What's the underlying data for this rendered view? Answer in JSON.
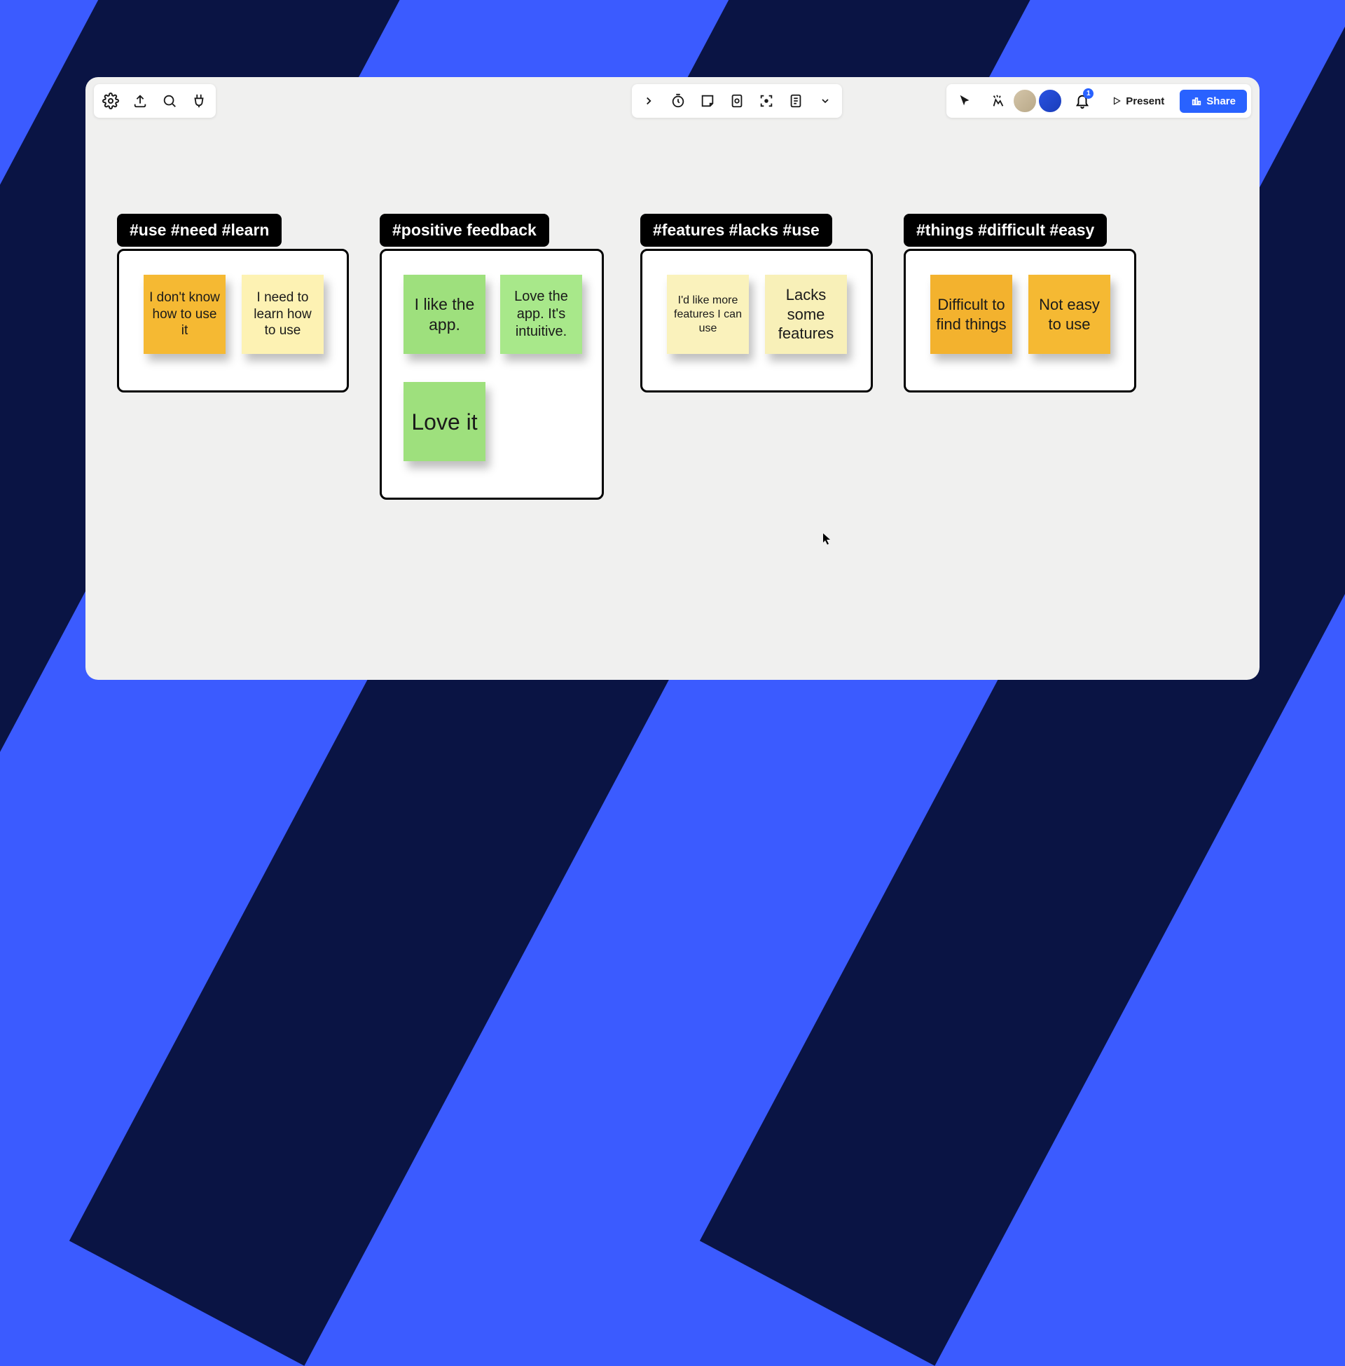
{
  "toolbar": {
    "present_label": "Present",
    "share_label": "Share",
    "notification_count": "1"
  },
  "clusters": [
    {
      "tag": "#use #need #learn",
      "notes": [
        {
          "text": "I don't know how to use it",
          "color": "orange"
        },
        {
          "text": "I need to learn how to use",
          "color": "yellow"
        }
      ]
    },
    {
      "tag": "#positive feedback",
      "notes": [
        {
          "text": "I like the app.",
          "color": "green1"
        },
        {
          "text": "Love the app. It's intuitive.",
          "color": "green2"
        },
        {
          "text": "Love it",
          "color": "green1"
        }
      ]
    },
    {
      "tag": "#features #lacks #use",
      "notes": [
        {
          "text": "I'd like more features I can use",
          "color": "yfade"
        },
        {
          "text": "Lacks some features",
          "color": "ylight"
        }
      ]
    },
    {
      "tag": "#things #difficult #easy",
      "notes": [
        {
          "text": "Difficult to find things",
          "color": "orange2"
        },
        {
          "text": "Not easy to use",
          "color": "orange"
        }
      ]
    }
  ]
}
